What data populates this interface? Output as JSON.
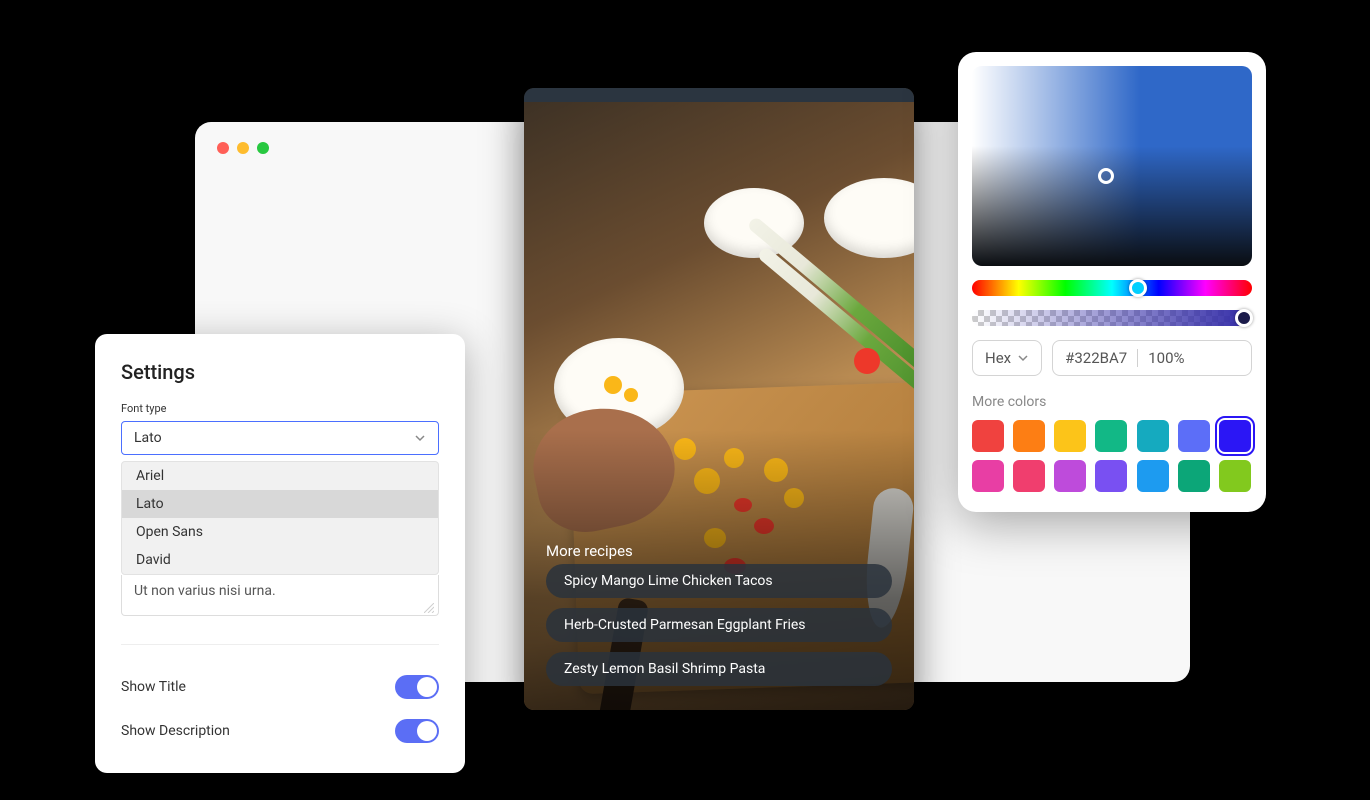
{
  "settings": {
    "title": "Settings",
    "font_type_label": "Font type",
    "font_selected": "Lato",
    "font_options": [
      "Ariel",
      "Lato",
      "Open Sans",
      "David"
    ],
    "textarea_value": "Ut non varius nisi urna.",
    "show_title_label": "Show Title",
    "show_description_label": "Show Description",
    "show_title_on": true,
    "show_description_on": true
  },
  "recipes": {
    "more_label": "More recipes",
    "items": [
      "Spicy Mango Lime Chicken Tacos",
      "Herb-Crusted Parmesan Eggplant Fries",
      "Zesty Lemon Basil Shrimp Pasta"
    ]
  },
  "colorpicker": {
    "mode_label": "Hex",
    "hex_value": "#322BA7",
    "alpha_value": "100%",
    "more_colors_label": "More colors",
    "swatches": [
      "#f0423f",
      "#fd7e14",
      "#fcc419",
      "#12b886",
      "#15aabf",
      "#5c6ef8",
      "#2b16f5",
      "#e83ea4",
      "#f03e6e",
      "#be4bdb",
      "#7950f2",
      "#1d9bf0",
      "#0ca678",
      "#82c91e"
    ],
    "selected_swatch_index": 6
  }
}
